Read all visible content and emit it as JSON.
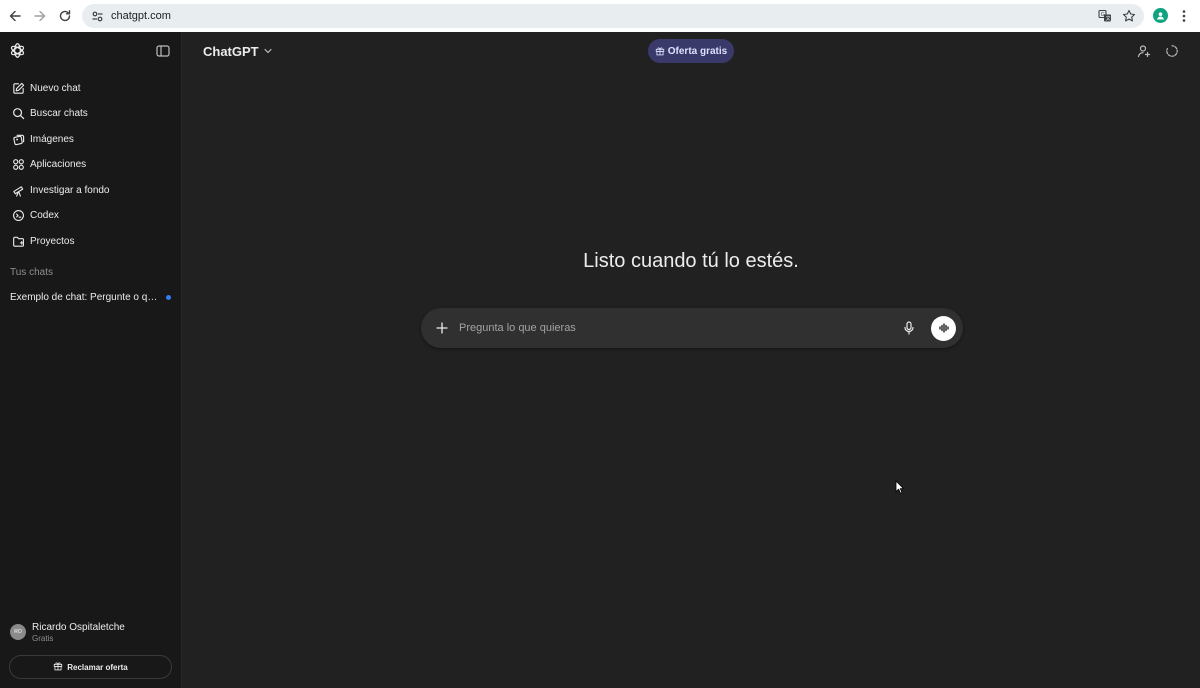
{
  "browser": {
    "url": "chatgpt.com",
    "icons": [
      "back-arrow-icon",
      "forward-arrow-icon",
      "reload-icon",
      "site-settings-icon",
      "translate-icon",
      "star-icon",
      "extension-avatar-icon",
      "kebab-menu-icon"
    ]
  },
  "sidebar": {
    "items": [
      {
        "label": "Nuevo chat",
        "icon": "edit-icon"
      },
      {
        "label": "Buscar chats",
        "icon": "search-icon"
      },
      {
        "label": "Imágenes",
        "icon": "images-icon"
      },
      {
        "label": "Aplicaciones",
        "icon": "apps-icon"
      },
      {
        "label": "Investigar a fondo",
        "icon": "telescope-icon"
      },
      {
        "label": "Codex",
        "icon": "codex-icon"
      },
      {
        "label": "Proyectos",
        "icon": "folder-icon"
      }
    ],
    "section_title": "Tus chats",
    "chats": [
      {
        "label": "Exemplo de chat: Pergunte o que quiser"
      }
    ],
    "user": {
      "initials": "RO",
      "name": "Ricardo Ospitaletche",
      "plan": "Gratis"
    },
    "claim_label": "Reclamar oferta"
  },
  "header": {
    "model_label": "ChatGPT",
    "offer_label": "Oferta gratis"
  },
  "main": {
    "headline": "Listo cuando tú lo estés.",
    "prompt_placeholder": "Pregunta lo que quieras"
  },
  "colors": {
    "sidebar_bg": "#181818",
    "main_bg": "#212121",
    "composer_bg": "#303030",
    "offer_bg": "#393a6a",
    "unread_dot": "#2f7ff6"
  }
}
